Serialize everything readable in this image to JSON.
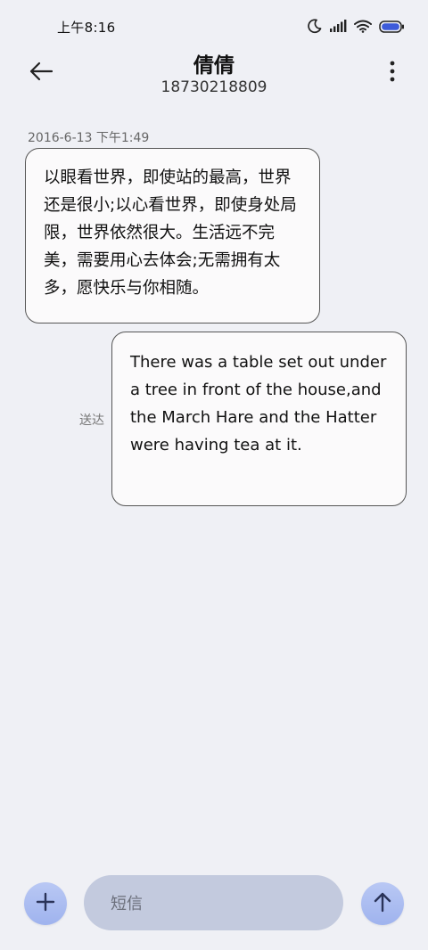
{
  "status_bar": {
    "time": "上午8:16",
    "icons": [
      "moon-icon",
      "signal-icon",
      "wifi-icon",
      "battery-icon"
    ]
  },
  "header": {
    "contact_name": "倩倩",
    "contact_number": "18730218809",
    "back_icon": "back-arrow-icon",
    "more_icon": "more-vertical-icon"
  },
  "conversation": {
    "timestamp": "2016-6-13 下午1:49",
    "messages": [
      {
        "direction": "incoming",
        "text": "以眼看世界，即使站的最高，世界还是很小;以心看世界，即使身处局限，世界依然很大。生活远不完美，需要用心去体会;无需拥有太多，愿快乐与你相随。"
      },
      {
        "direction": "outgoing",
        "text": "There was a table set out under a tree in front of the house,and the March Hare and the Hatter were having tea at it.",
        "status": "送达"
      }
    ]
  },
  "composer": {
    "placeholder": "短信",
    "value": "",
    "add_icon": "plus-icon",
    "send_icon": "arrow-up-icon"
  },
  "colors": {
    "background": "#eff0f5",
    "bubble": "#fbfafb",
    "bubble_border": "#555555",
    "accent_button": "#a9bbf1",
    "input_background": "#c3cade",
    "battery_accent": "#3d5bd9"
  }
}
